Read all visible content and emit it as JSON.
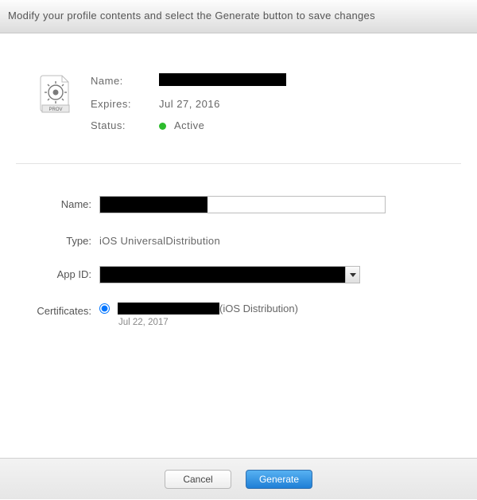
{
  "header": {
    "instruction": "Modify your profile contents and select the Generate button to save changes"
  },
  "summary": {
    "name_label": "Name:",
    "name_value": "",
    "expires_label": "Expires:",
    "expires_value": "Jul 27, 2016",
    "status_label": "Status:",
    "status_value": "Active",
    "status_color": "#2cbb2c",
    "icon_caption": "PROV"
  },
  "form": {
    "name_label": "Name:",
    "name_value": "",
    "type_label": "Type:",
    "type_value": "iOS UniversalDistribution",
    "appid_label": "App ID:",
    "appid_value": "",
    "certificates_label": "Certificates:",
    "cert_prefix": "",
    "cert_suffix": "(iOS Distribution)",
    "cert_date": "Jul 22, 2017"
  },
  "footer": {
    "cancel": "Cancel",
    "generate": "Generate"
  }
}
